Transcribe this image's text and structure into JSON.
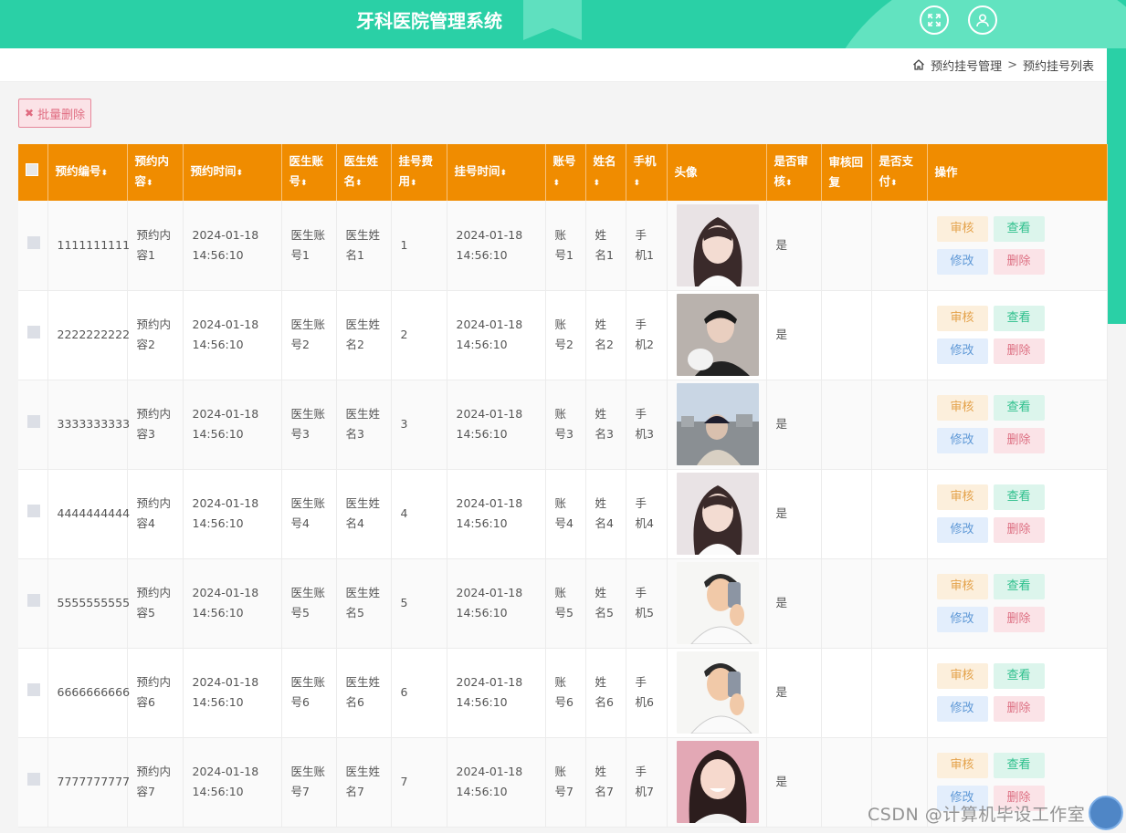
{
  "header": {
    "title": "牙科医院管理系统"
  },
  "breadcrumb": {
    "level1": "预约挂号管理",
    "separator": ">",
    "level2": "预约挂号列表"
  },
  "toolbar": {
    "batch_delete_label": "批量删除"
  },
  "table": {
    "columns": [
      {
        "label": "预约编号",
        "sortable": true
      },
      {
        "label": "预约内容",
        "sortable": true
      },
      {
        "label": "预约时间",
        "sortable": true
      },
      {
        "label": "医生账号",
        "sortable": true
      },
      {
        "label": "医生姓名",
        "sortable": true
      },
      {
        "label": "挂号费用",
        "sortable": true
      },
      {
        "label": "挂号时间",
        "sortable": true
      },
      {
        "label": "账号",
        "sortable": true
      },
      {
        "label": "姓名",
        "sortable": true
      },
      {
        "label": "手机",
        "sortable": true
      },
      {
        "label": "头像",
        "sortable": false
      },
      {
        "label": "是否审核",
        "sortable": true
      },
      {
        "label": "审核回复",
        "sortable": false
      },
      {
        "label": "是否支付",
        "sortable": true
      },
      {
        "label": "操作",
        "sortable": false
      }
    ],
    "sort_glyph": "⬍",
    "actions": {
      "review": "审核",
      "view": "查看",
      "edit": "修改",
      "delete": "删除"
    },
    "rows": [
      {
        "id": "1111111111",
        "content": "预约内容1",
        "time": "2024-01-18 14:56:10",
        "doctor_account": "医生账号1",
        "doctor_name": "医生姓名1",
        "fee": "1",
        "reg_time": "2024-01-18 14:56:10",
        "account": "账号1",
        "name": "姓名1",
        "phone": "手机1",
        "avatar": "girl-portrait",
        "reviewed": "是",
        "reply": "",
        "paid": ""
      },
      {
        "id": "2222222222",
        "content": "预约内容2",
        "time": "2024-01-18 14:56:10",
        "doctor_account": "医生账号2",
        "doctor_name": "医生姓名2",
        "fee": "2",
        "reg_time": "2024-01-18 14:56:10",
        "account": "账号2",
        "name": "姓名2",
        "phone": "手机2",
        "avatar": "boy-with-cat",
        "reviewed": "是",
        "reply": "",
        "paid": ""
      },
      {
        "id": "3333333333",
        "content": "预约内容3",
        "time": "2024-01-18 14:56:10",
        "doctor_account": "医生账号3",
        "doctor_name": "医生姓名3",
        "fee": "3",
        "reg_time": "2024-01-18 14:56:10",
        "account": "账号3",
        "name": "姓名3",
        "phone": "手机3",
        "avatar": "city-view",
        "reviewed": "是",
        "reply": "",
        "paid": ""
      },
      {
        "id": "4444444444",
        "content": "预约内容4",
        "time": "2024-01-18 14:56:10",
        "doctor_account": "医生账号4",
        "doctor_name": "医生姓名4",
        "fee": "4",
        "reg_time": "2024-01-18 14:56:10",
        "account": "账号4",
        "name": "姓名4",
        "phone": "手机4",
        "avatar": "girl-portrait",
        "reviewed": "是",
        "reply": "",
        "paid": ""
      },
      {
        "id": "5555555555",
        "content": "预约内容5",
        "time": "2024-01-18 14:56:10",
        "doctor_account": "医生账号5",
        "doctor_name": "医生姓名5",
        "fee": "5",
        "reg_time": "2024-01-18 14:56:10",
        "account": "账号5",
        "name": "姓名5",
        "phone": "手机5",
        "avatar": "cartoon-selfie",
        "reviewed": "是",
        "reply": "",
        "paid": ""
      },
      {
        "id": "6666666666",
        "content": "预约内容6",
        "time": "2024-01-18 14:56:10",
        "doctor_account": "医生账号6",
        "doctor_name": "医生姓名6",
        "fee": "6",
        "reg_time": "2024-01-18 14:56:10",
        "account": "账号6",
        "name": "姓名6",
        "phone": "手机6",
        "avatar": "cartoon-selfie",
        "reviewed": "是",
        "reply": "",
        "paid": ""
      },
      {
        "id": "7777777777",
        "content": "预约内容7",
        "time": "2024-01-18 14:56:10",
        "doctor_account": "医生账号7",
        "doctor_name": "医生姓名7",
        "fee": "7",
        "reg_time": "2024-01-18 14:56:10",
        "account": "账号7",
        "name": "姓名7",
        "phone": "手机7",
        "avatar": "smiling-girl",
        "reviewed": "是",
        "reply": "",
        "paid": ""
      }
    ]
  },
  "watermark": "CSDN @计算机毕设工作室",
  "colors": {
    "header_bg": "#2ad0a6",
    "table_header_bg": "#f08c00",
    "danger": "#dd6f82"
  }
}
